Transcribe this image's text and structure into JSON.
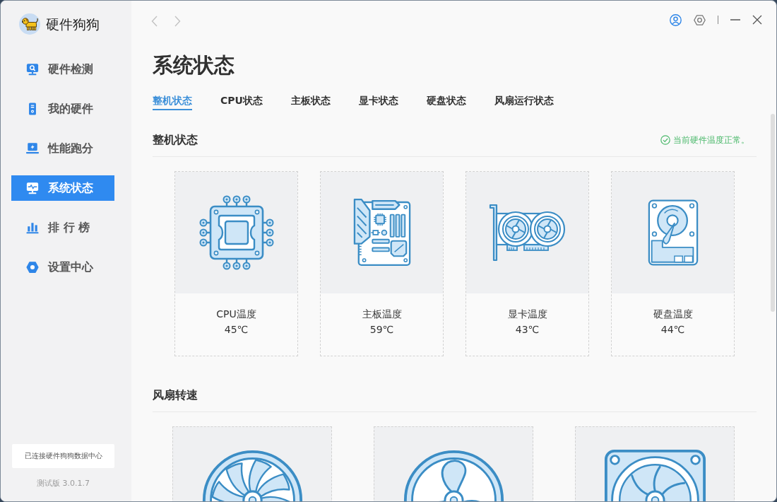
{
  "app": {
    "name": "硬件狗狗"
  },
  "nav": [
    {
      "kind": "monitor",
      "label": "硬件检测",
      "selected": false
    },
    {
      "kind": "tower",
      "label": "我的硬件",
      "selected": false
    },
    {
      "kind": "laptop",
      "label": "性能跑分",
      "selected": false
    },
    {
      "kind": "pulse",
      "label": "系统状态",
      "selected": true
    },
    {
      "kind": "chart",
      "label": "排 行 榜",
      "selected": false
    },
    {
      "kind": "hexagon",
      "label": "设置中心",
      "selected": false
    }
  ],
  "sidebar_footer": {
    "connection": "已连接硬件狗狗数据中心",
    "version": "测试版 3.0.1.7"
  },
  "page": {
    "title": "系统状态",
    "tabs": [
      {
        "label": "整机状态",
        "selected": true
      },
      {
        "label": "CPU状态",
        "selected": false
      },
      {
        "label": "主板状态",
        "selected": false
      },
      {
        "label": "显卡状态",
        "selected": false
      },
      {
        "label": "硬盘状态",
        "selected": false
      },
      {
        "label": "风扇运行状态",
        "selected": false
      }
    ]
  },
  "system_status": {
    "title": "整机状态",
    "status": "当前硬件温度正常。",
    "cards": [
      {
        "kind": "cpu",
        "label": "CPU温度",
        "value": "45℃"
      },
      {
        "kind": "motherboard",
        "label": "主板温度",
        "value": "59℃"
      },
      {
        "kind": "gpu",
        "label": "显卡温度",
        "value": "43℃"
      },
      {
        "kind": "disk",
        "label": "硬盘温度",
        "value": "44℃"
      }
    ]
  },
  "fan_speed": {
    "title": "风扇转速",
    "fans": [
      {
        "kind": "blower"
      },
      {
        "kind": "propeller"
      },
      {
        "kind": "framed"
      }
    ]
  }
}
